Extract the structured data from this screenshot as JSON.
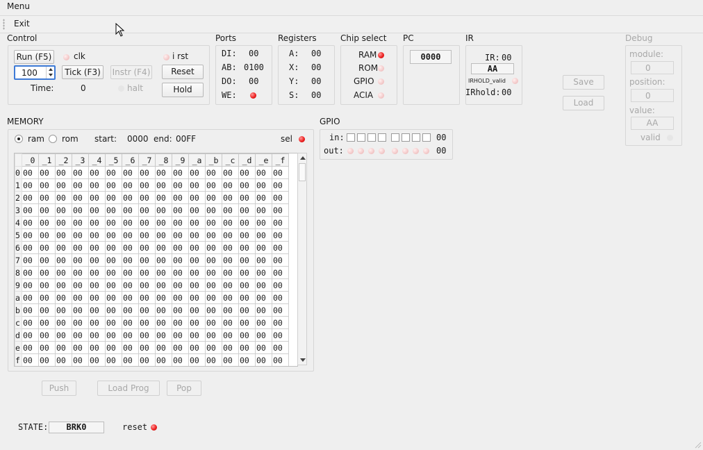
{
  "menubar": {
    "menu_label": "Menu",
    "exit_label": "Exit"
  },
  "control": {
    "title": "Control",
    "run_label": "Run (F5)",
    "tick_label": "Tick (F3)",
    "instr_label": "Instr (F4)",
    "reset_label": "Reset",
    "hold_label": "Hold",
    "clk_label": "clk",
    "rst_label": "i rst",
    "halt_label": "halt",
    "speed_value": "100",
    "time_label": "Time:",
    "time_value": "0"
  },
  "ports": {
    "title": "Ports",
    "rows": [
      {
        "label": "DI:",
        "value": "00"
      },
      {
        "label": "AB:",
        "value": "0100"
      },
      {
        "label": "DO:",
        "value": "00"
      },
      {
        "label": "WE:",
        "value": ""
      }
    ]
  },
  "registers": {
    "title": "Registers",
    "rows": [
      {
        "label": "A:",
        "value": "00"
      },
      {
        "label": "X:",
        "value": "00"
      },
      {
        "label": "Y:",
        "value": "00"
      },
      {
        "label": "S:",
        "value": "00"
      }
    ]
  },
  "chip_select": {
    "title": "Chip select",
    "items": [
      "RAM",
      "ROM",
      "GPIO",
      "ACIA"
    ]
  },
  "pc": {
    "title": "PC",
    "value": "0000"
  },
  "ir": {
    "title": "IR",
    "ir_label": "IR:",
    "ir_value": "00",
    "ir_field": "AA",
    "irhold_valid_label": "IRHOLD_valid",
    "irhold_label": "IRhold:",
    "irhold_value": "00"
  },
  "side": {
    "save_label": "Save",
    "load_label": "Load"
  },
  "debug": {
    "title": "Debug",
    "module_label": "module:",
    "module_value": "0",
    "position_label": "position:",
    "position_value": "0",
    "value_label": "value:",
    "value_value": "AA",
    "valid_label": "valid"
  },
  "memory": {
    "title": "MEMORY",
    "ram_label": "ram",
    "rom_label": "rom",
    "start_label": "start:",
    "start_value": "0000",
    "end_label": "end:",
    "end_value": "00FF",
    "sel_label": "sel",
    "columns": [
      "_0",
      "_1",
      "_2",
      "_3",
      "_4",
      "_5",
      "_6",
      "_7",
      "_8",
      "_9",
      "_a",
      "_b",
      "_c",
      "_d",
      "_e",
      "_f"
    ],
    "rows": [
      "0",
      "1",
      "2",
      "3",
      "4",
      "5",
      "6",
      "7",
      "8",
      "9",
      "a",
      "b",
      "c",
      "d",
      "e",
      "f"
    ],
    "cell_value": "00"
  },
  "gpio": {
    "title": "GPIO",
    "in_label": "in:",
    "in_value": "00",
    "out_label": "out:",
    "out_value": "00"
  },
  "bottom": {
    "push_label": "Push",
    "load_prog_label": "Load Prog",
    "pop_label": "Pop"
  },
  "status": {
    "state_label": "STATE:",
    "state_value": "BRK0",
    "reset_label": "reset"
  },
  "colors": {
    "led_on": "#e22222",
    "led_off": "#f3c9c9",
    "background": "#efefef"
  }
}
